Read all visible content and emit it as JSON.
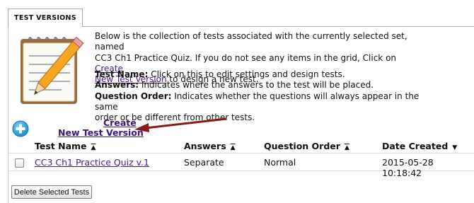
{
  "tab": {
    "label": "TEST VERSIONS"
  },
  "description": {
    "line1": "Below is the collection of tests associated with the currently selected set, named",
    "line2_prefix": "CC3 Ch1 Practice Quiz. If you do not see any items in the grid, Click on ",
    "create_link1": "Create",
    "line3_link": "New Test Version",
    "line3_suffix": " to design a new test."
  },
  "help": {
    "test_name_term": "Test Name:",
    "test_name_text": " Click on this to edit settings and design tests.",
    "answers_term": "Answers:",
    "answers_text": " Indicates where the answers to the test will be placed.",
    "question_order_term": "Question Order:",
    "question_order_text": " Indicates whether the questions will always appear in the same",
    "question_order_text2": "order or be different from other tests."
  },
  "create": {
    "line1": "Create",
    "line2": "New Test Version"
  },
  "table": {
    "columns": [
      "Test Name",
      "Answers",
      "Question Order",
      "Date Created"
    ],
    "rows": [
      {
        "test_name": "CC3 Ch1 Practice Quiz v.1",
        "answers": "Separate",
        "question_order": "Normal",
        "date_created": "2015-05-28 10:18:42"
      }
    ]
  },
  "buttons": {
    "delete_selected": "Delete Selected Tests"
  },
  "colors": {
    "link": "#4b1a8a",
    "arrow": "#8b1a1a",
    "add_icon": "#1a9ad6"
  }
}
